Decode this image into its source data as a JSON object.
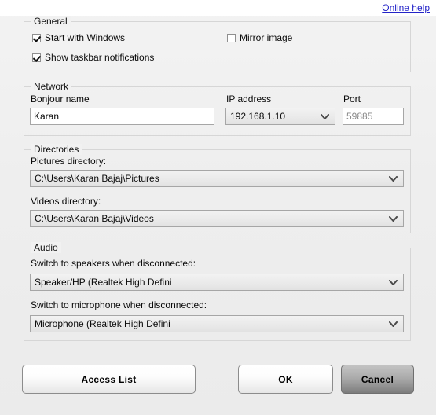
{
  "header": {
    "help_link": "Online help"
  },
  "general": {
    "legend": "General",
    "checkboxes": [
      {
        "label": "Start with Windows",
        "checked": true
      },
      {
        "label": "Show taskbar notifications",
        "checked": true
      },
      {
        "label": "Mirror image",
        "checked": false
      }
    ]
  },
  "network": {
    "legend": "Network",
    "bonjour_label": "Bonjour name",
    "bonjour_value": "Karan",
    "ip_label": "IP address",
    "ip_value": "192.168.1.10",
    "port_label": "Port",
    "port_value": "59885"
  },
  "directories": {
    "legend": "Directories",
    "pictures_label": "Pictures directory:",
    "pictures_value": "C:\\Users\\Karan Bajaj\\Pictures",
    "videos_label": "Videos directory:",
    "videos_value": "C:\\Users\\Karan Bajaj\\Videos"
  },
  "audio": {
    "legend": "Audio",
    "speakers_label": "Switch to speakers when disconnected:",
    "speakers_value": "Speaker/HP (Realtek High Defini",
    "microphone_label": "Switch to microphone when disconnected:",
    "microphone_value": "Microphone (Realtek High Defini"
  },
  "buttons": {
    "access_list": "Access List",
    "ok": "OK",
    "cancel": "Cancel"
  },
  "colors": {
    "link": "#2424c8",
    "window_bg": "#f1f1f1",
    "group_border": "#d6d6d6",
    "input_border": "#a6a6a6",
    "muted_text": "#8a8a8a"
  }
}
